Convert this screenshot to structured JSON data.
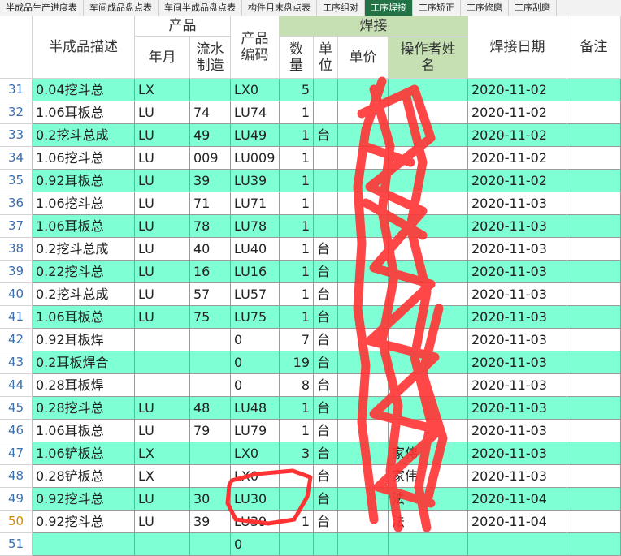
{
  "sheet_tabs": [
    {
      "label": "半成品生产进度表",
      "active": false
    },
    {
      "label": "车间成品盘点表",
      "active": false
    },
    {
      "label": "车间半成品盘点表",
      "active": false
    },
    {
      "label": "构件月末盘点表",
      "active": false
    },
    {
      "label": "工序组对",
      "active": false
    },
    {
      "label": "工序焊接",
      "active": true
    },
    {
      "label": "工序矫正",
      "active": false
    },
    {
      "label": "工序修磨",
      "active": false
    },
    {
      "label": "工序刮磨",
      "active": false
    }
  ],
  "header": {
    "desc": "半成品描述",
    "product": "产品",
    "year_month": "年月",
    "serial": "流水制造",
    "product_code": "产品编码",
    "weld": "焊接",
    "qty": "数量",
    "unit": "单位",
    "price": "单价",
    "operator": "操作者姓名",
    "weld_date": "焊接日期",
    "remark": "备注"
  },
  "colors": {
    "teal": "#7fffd4",
    "white": "#ffffff",
    "weld_header": "#c6e0b4",
    "active_tab": "#217346",
    "scribble": "#ff3333"
  },
  "rows": [
    {
      "n": "31",
      "desc": "0.04挖斗总",
      "ym": "LX",
      "serial": "",
      "code": "LX0",
      "qty": "5",
      "unit": "",
      "price": "",
      "op": "",
      "date": "2020-11-02",
      "teal": true
    },
    {
      "n": "32",
      "desc": "1.06耳板总",
      "ym": "LU",
      "serial": "74",
      "code": "LU74",
      "qty": "1",
      "unit": "",
      "price": "",
      "op": "",
      "date": "2020-11-02",
      "teal": false
    },
    {
      "n": "33",
      "desc": "0.2挖斗总成",
      "ym": "LU",
      "serial": "49",
      "code": "LU49",
      "qty": "1",
      "unit": "台",
      "price": "",
      "op": "",
      "date": "2020-11-02",
      "teal": true
    },
    {
      "n": "34",
      "desc": "1.06挖斗总",
      "ym": "LU",
      "serial": "009",
      "code": "LU009",
      "qty": "1",
      "unit": "",
      "price": "",
      "op": "",
      "date": "2020-11-02",
      "teal": false
    },
    {
      "n": "35",
      "desc": "0.92耳板总",
      "ym": "LU",
      "serial": "39",
      "code": "LU39",
      "qty": "1",
      "unit": "",
      "price": "",
      "op": "",
      "date": "2020-11-02",
      "teal": true
    },
    {
      "n": "36",
      "desc": "1.06挖斗总",
      "ym": "LU",
      "serial": "71",
      "code": "LU71",
      "qty": "1",
      "unit": "",
      "price": "",
      "op": "",
      "date": "2020-11-03",
      "teal": false
    },
    {
      "n": "37",
      "desc": "1.06耳板总",
      "ym": "LU",
      "serial": "78",
      "code": "LU78",
      "qty": "1",
      "unit": "",
      "price": "",
      "op": "",
      "date": "2020-11-03",
      "teal": true
    },
    {
      "n": "38",
      "desc": "0.2挖斗总成",
      "ym": "LU",
      "serial": "40",
      "code": "LU40",
      "qty": "1",
      "unit": "台",
      "price": "",
      "op": "",
      "date": "2020-11-03",
      "teal": false
    },
    {
      "n": "39",
      "desc": "0.22挖斗总",
      "ym": "LU",
      "serial": "16",
      "code": "LU16",
      "qty": "1",
      "unit": "台",
      "price": "",
      "op": "",
      "date": "2020-11-03",
      "teal": true
    },
    {
      "n": "40",
      "desc": "0.2挖斗总成",
      "ym": "LU",
      "serial": "57",
      "code": "LU57",
      "qty": "1",
      "unit": "台",
      "price": "",
      "op": "",
      "date": "2020-11-03",
      "teal": false
    },
    {
      "n": "41",
      "desc": "1.06耳板总",
      "ym": "LU",
      "serial": "75",
      "code": "LU75",
      "qty": "1",
      "unit": "台",
      "price": "",
      "op": "",
      "date": "2020-11-03",
      "teal": true
    },
    {
      "n": "42",
      "desc": "0.92耳板焊",
      "ym": "",
      "serial": "",
      "code": "0",
      "qty": "7",
      "unit": "台",
      "price": "",
      "op": "",
      "date": "2020-11-03",
      "teal": false
    },
    {
      "n": "43",
      "desc": "0.2耳板焊合",
      "ym": "",
      "serial": "",
      "code": "0",
      "qty": "19",
      "unit": "台",
      "price": "",
      "op": "",
      "date": "2020-11-03",
      "teal": true
    },
    {
      "n": "44",
      "desc": "0.28耳板焊",
      "ym": "",
      "serial": "",
      "code": "0",
      "qty": "8",
      "unit": "台",
      "price": "",
      "op": "",
      "date": "2020-11-03",
      "teal": false
    },
    {
      "n": "45",
      "desc": "0.28挖斗总",
      "ym": "LU",
      "serial": "48",
      "code": "LU48",
      "qty": "1",
      "unit": "台",
      "price": "",
      "op": "",
      "date": "2020-11-03",
      "teal": true
    },
    {
      "n": "46",
      "desc": "1.06耳板总",
      "ym": "LU",
      "serial": "79",
      "code": "LU79",
      "qty": "1",
      "unit": "台",
      "price": "",
      "op": "",
      "date": "2020-11-03",
      "teal": false
    },
    {
      "n": "47",
      "desc": "1.06铲板总",
      "ym": "LX",
      "serial": "",
      "code": "LX0",
      "qty": "3",
      "unit": "台",
      "price": "",
      "op": "家伟",
      "date": "2020-11-03",
      "teal": true
    },
    {
      "n": "48",
      "desc": "0.28铲板总",
      "ym": "LX",
      "serial": "",
      "code": "LX0",
      "qty": "",
      "unit": "台",
      "price": "",
      "op": "家伟",
      "date": "2020-11-03",
      "teal": false
    },
    {
      "n": "49",
      "desc": "0.92挖斗总",
      "ym": "LU",
      "serial": "30",
      "code": "LU30",
      "qty": "",
      "unit": "台",
      "price": "",
      "op": "法",
      "date": "2020-11-04",
      "teal": true
    },
    {
      "n": "50",
      "desc": "0.92挖斗总",
      "ym": "LU",
      "serial": "39",
      "code": "LU39",
      "qty": "1",
      "unit": "台",
      "price": "",
      "op": "法",
      "date": "2020-11-04",
      "teal": false
    },
    {
      "n": "51",
      "desc": "",
      "ym": "",
      "serial": "",
      "code": "0",
      "qty": "",
      "unit": "",
      "price": "",
      "op": "",
      "date": "",
      "teal": true
    }
  ]
}
